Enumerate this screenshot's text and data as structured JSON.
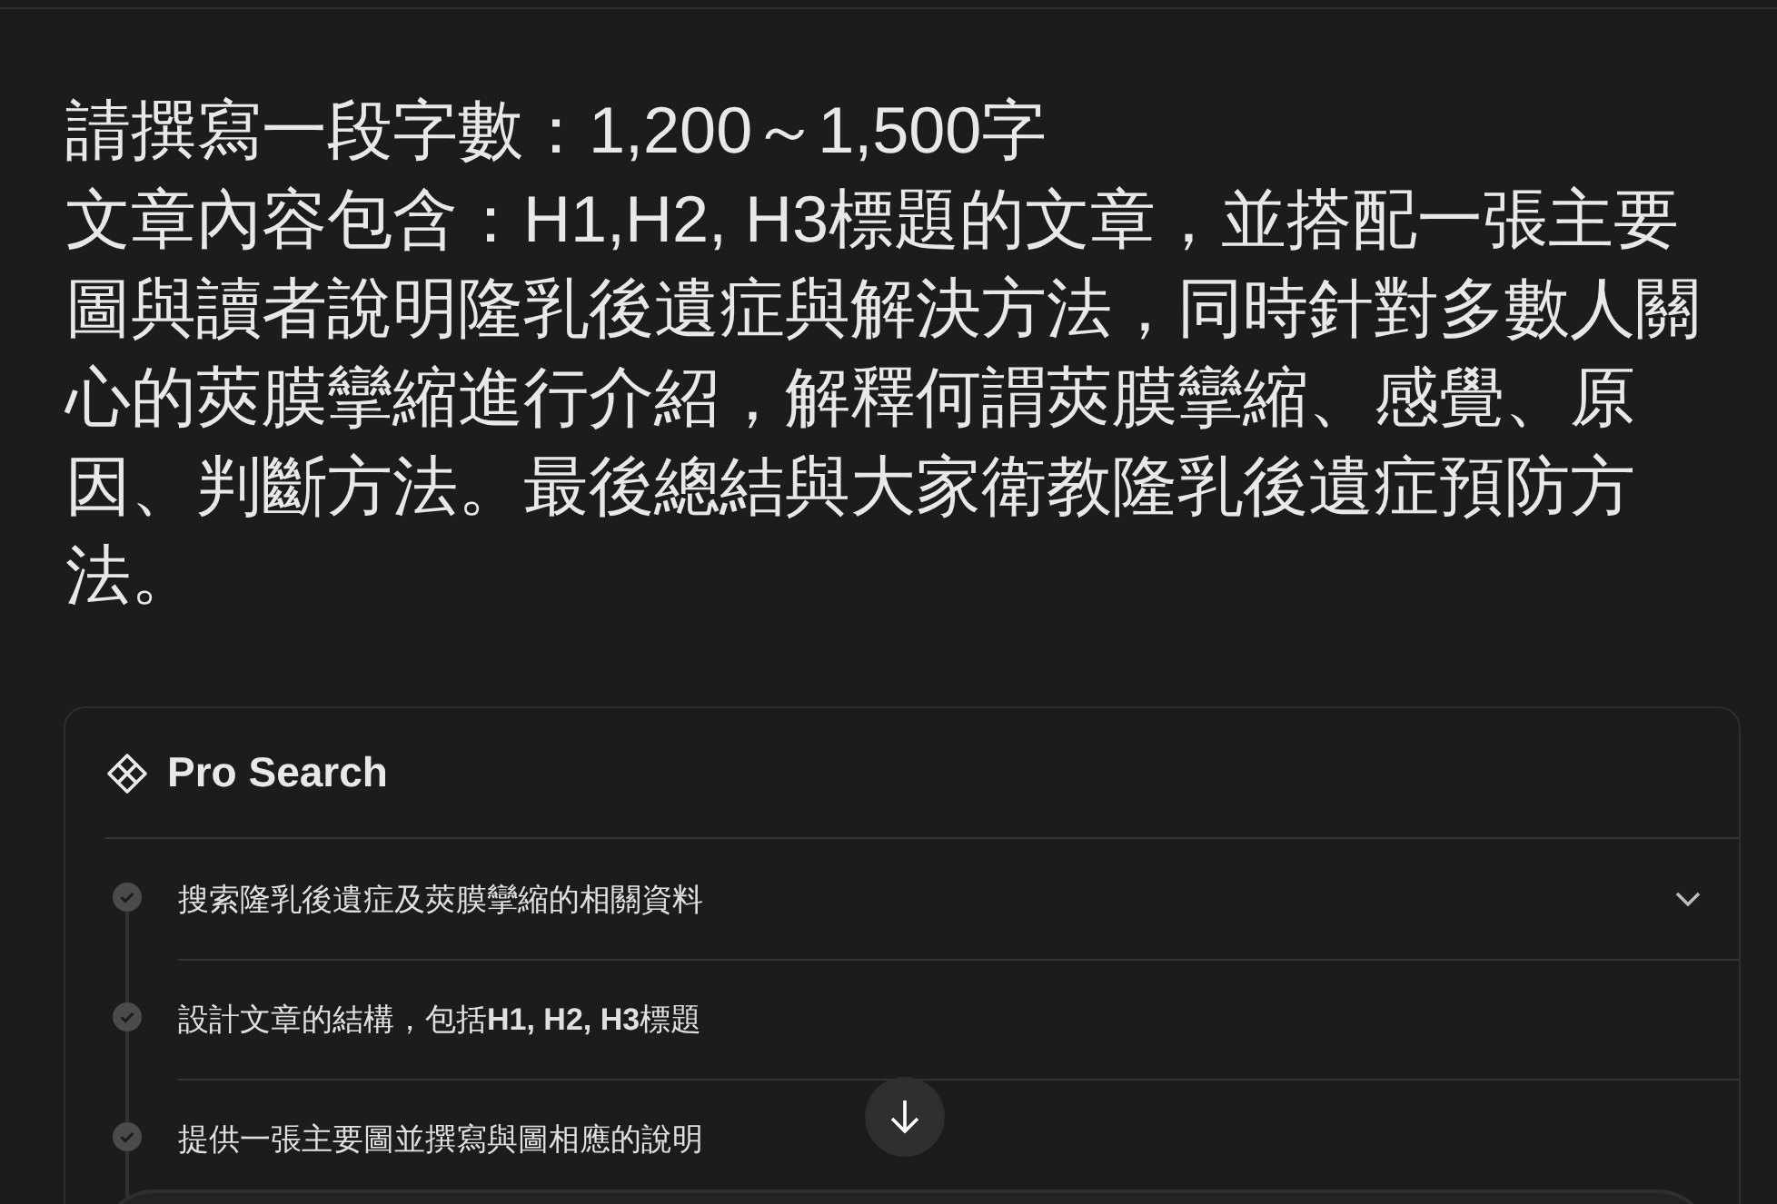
{
  "question": {
    "lines": [
      "請撰寫一段字數：1,200～1,500字",
      "文章內容包含：H1,H2, H3標題的文章，並搭配一張主要圖與讀者說明隆乳後遺症與解決方法，同時針對多數人關心的莢膜攣縮進行介紹，解釋何謂莢膜攣縮、感覺、原因、判斷方法。最後總結與大家衛教隆乳後遺症預防方法。"
    ]
  },
  "pro_search": {
    "title": "Pro Search",
    "expanded": true,
    "steps": [
      {
        "text": "搜索隆乳後遺症及莢膜攣縮的相關資料",
        "done": true
      },
      {
        "text": "設計文章的結構，包括**H1, H2, H3**標題",
        "done": true
      },
      {
        "text": "提供一張主要圖並撰寫與圖相應的說明",
        "done": true
      }
    ]
  }
}
